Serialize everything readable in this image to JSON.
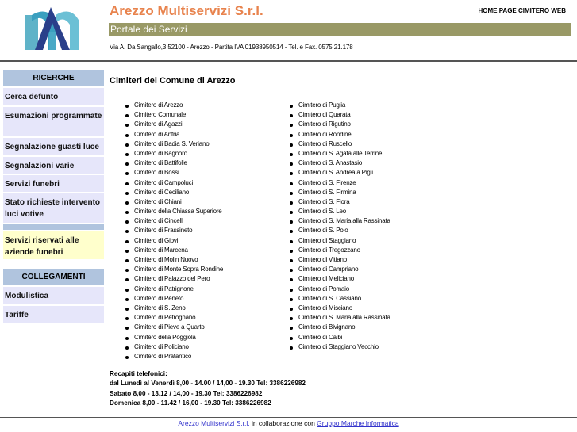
{
  "header": {
    "title": "Arezzo Multiservizi S.r.l.",
    "home_link": "HOME PAGE CIMITERO WEB",
    "subtitle": "Portale dei Servizi",
    "address": "Via A. Da Sangallo,3 52100 - Arezzo - Partita IVA 01938950514 - Tel. e Fax. 0575 21.178"
  },
  "sidebar": {
    "ricerche_header": "RICERCHE",
    "items": [
      "Cerca defunto",
      "Esumazioni programmate",
      "Segnalazione guasti luce",
      "Segnalazioni varie",
      "Servizi funebri",
      "Stato richieste intervento luci votive"
    ],
    "reserved": "Servizi riservati alle aziende funebri",
    "collegamenti_header": "COLLEGAMENTI",
    "links": [
      "Modulistica",
      "Tariffe"
    ]
  },
  "main": {
    "title": "Cimiteri del Comune di Arezzo",
    "col1": [
      "Cimitero di Arezzo",
      "Cimitero Comunale",
      "Cimitero di Agazzi",
      "Cimitero di Antria",
      "Cimitero di Badia S. Veriano",
      "Cimitero di Bagnoro",
      "Cimitero di Battifolle",
      "Cimitero di Bossi",
      "Cimitero di Campoluci",
      "Cimitero di Ceciliano",
      "Cimitero di Chiani",
      "Cimitero della Chiassa Superiore",
      "Cimitero di Cincelli",
      "Cimitero di Frassineto",
      "Cimitero di Giovi",
      "Cimitero di Marcena",
      "Cimitero di Molin Nuovo",
      "Cimitero di Monte Sopra Rondine",
      "Cimitero di Palazzo del Pero",
      "Cimitero di Patrignone",
      "Cimitero di Peneto",
      "Cimitero di S. Zeno",
      "Cimitero di Petrognano",
      "Cimitero di Pieve a Quarto",
      "Cimitero della Poggiola",
      "Cimitero di Policiano",
      "Cimitero di Pratantico"
    ],
    "col2": [
      "Cimitero di Puglia",
      "Cimitero di Quarata",
      "Cimitero di Rigutino",
      "Cimitero di Rondine",
      "Cimitero di Ruscello",
      "Cimitero di S. Agata alle Terrine",
      "Cimitero di S. Anastasio",
      "Cimitero di S. Andrea a Pigli",
      "Cimitero di S. Firenze",
      "Cimitero di S. Firmina",
      "Cimitero di S. Flora",
      "Cimitero di S. Leo",
      "Cimitero di S. Maria alla Rassinata",
      "Cimitero di S. Polo",
      "Cimitero di Staggiano",
      "Cimitero di Tregozzano",
      "Cimitero di Vitiano",
      "Cimitero di Campriano",
      "Cimitero di Meliciano",
      "Cimitero di Pomaio",
      "Cimitero di S. Cassiano",
      "Cimitero di Misciano",
      "Cimitero di S. Maria alla Rassinata",
      "Cimitero di Bivignano",
      "Cimitero di Calbi",
      "Cimitero di Staggiano Vecchio"
    ],
    "contacts": [
      "Recapiti telefonici:",
      "dal Lunedì al Venerdì 8,00 - 14.00 / 14,00 - 19.30 Tel: 3386226982",
      "Sabato 8,00 - 13.12 / 14,00 - 19.30 Tel: 3386226982",
      "Domenica 8,00 - 11.42 / 16,00 - 19.30 Tel: 3386226982"
    ]
  },
  "footer": {
    "company_link": "Arezzo Multiservizi S.r.l.",
    "middle": " in collaborazione con ",
    "partner_link": "Gruppo Marche Informatica"
  }
}
